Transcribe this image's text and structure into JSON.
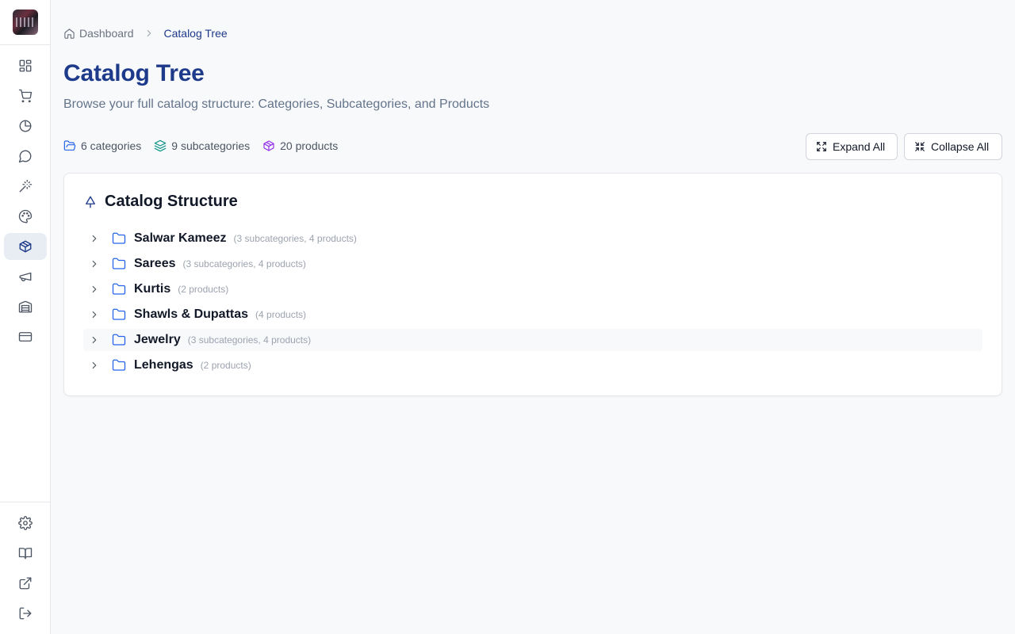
{
  "breadcrumb": {
    "home": "Dashboard",
    "current": "Catalog Tree"
  },
  "page": {
    "title": "Catalog Tree",
    "subtitle": "Browse your full catalog structure: Categories, Subcategories, and Products"
  },
  "stats": {
    "categories": "6 categories",
    "subcategories": "9 subcategories",
    "products": "20 products"
  },
  "actions": {
    "expand_all": "Expand All",
    "collapse_all": "Collapse All"
  },
  "card": {
    "title": "Catalog Structure"
  },
  "categories": [
    {
      "name": "Salwar Kameez",
      "meta": "(3 subcategories, 4 products)"
    },
    {
      "name": "Sarees",
      "meta": "(3 subcategories, 4 products)"
    },
    {
      "name": "Kurtis",
      "meta": "(2 products)"
    },
    {
      "name": "Shawls & Dupattas",
      "meta": "(4 products)"
    },
    {
      "name": "Jewelry",
      "meta": "(3 subcategories, 4 products)"
    },
    {
      "name": "Lehengas",
      "meta": "(2 products)"
    }
  ],
  "colors": {
    "brand": "#1e3a8a",
    "folder": "#2563eb",
    "stat_categories": "#2563eb",
    "stat_subcategories": "#0d9488",
    "stat_products": "#9333ea"
  },
  "icons": {
    "sidebar": [
      "dashboard-icon",
      "cart-icon",
      "pie-chart-icon",
      "message-icon",
      "magic-wand-icon",
      "palette-icon",
      "box-icon",
      "megaphone-icon",
      "warehouse-icon",
      "credit-card-icon"
    ],
    "sidebar_bottom": [
      "gear-icon",
      "book-icon",
      "external-link-icon",
      "logout-icon"
    ]
  }
}
